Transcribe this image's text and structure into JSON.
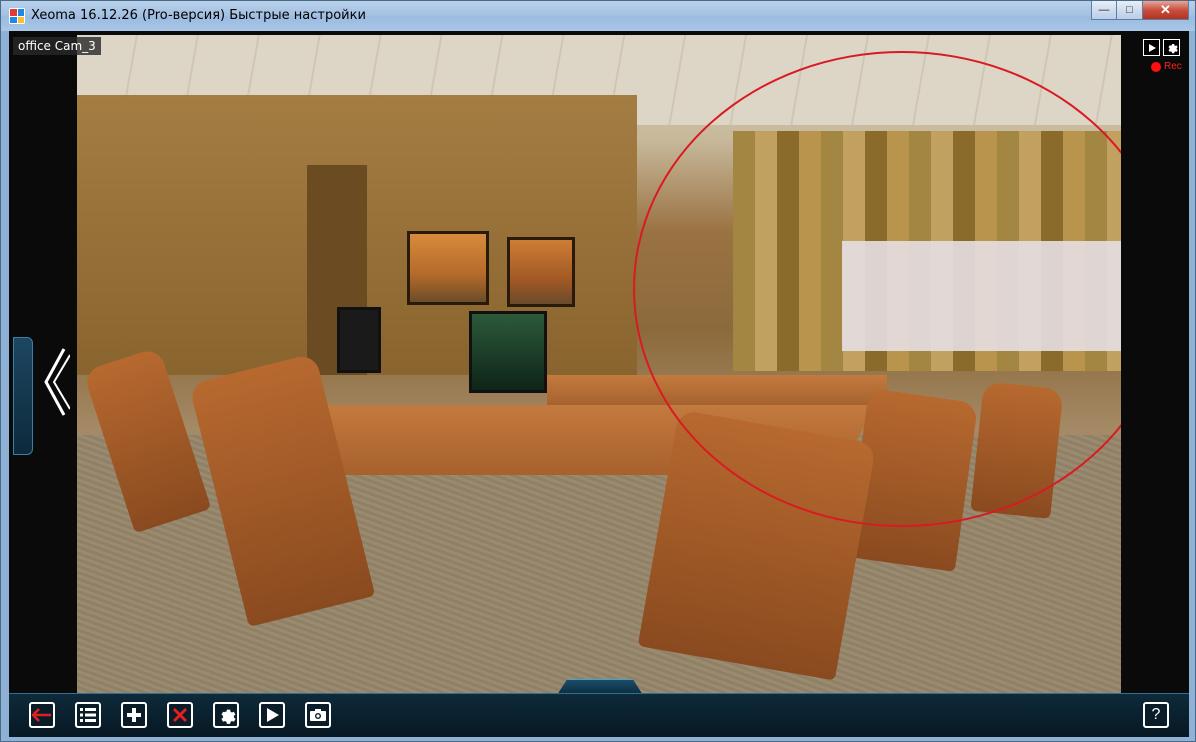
{
  "window": {
    "title": "Xeoma 16.12.26 (Pro-версия) Быстрые настройки",
    "controls": {
      "minimize": "—",
      "maximize": "□",
      "close": "✕"
    }
  },
  "camera": {
    "label": "office Cam_3",
    "rec_label": "Rec",
    "tool_icons": [
      "play-icon",
      "gear-icon"
    ]
  },
  "toolbar": {
    "buttons": [
      {
        "name": "back-button",
        "icon": "arrow-left-icon"
      },
      {
        "name": "list-button",
        "icon": "list-icon"
      },
      {
        "name": "add-button",
        "icon": "plus-icon"
      },
      {
        "name": "delete-button",
        "icon": "cross-icon"
      },
      {
        "name": "settings-button",
        "icon": "gear-icon"
      },
      {
        "name": "play-button",
        "icon": "play-icon"
      },
      {
        "name": "snapshot-button",
        "icon": "camera-icon"
      }
    ],
    "help_label": "?"
  },
  "colors": {
    "accent": "#2f6f96",
    "rec": "#ff1010",
    "delete": "#e02020",
    "back": "#e02020",
    "highlight_circle": "#d81b22"
  }
}
